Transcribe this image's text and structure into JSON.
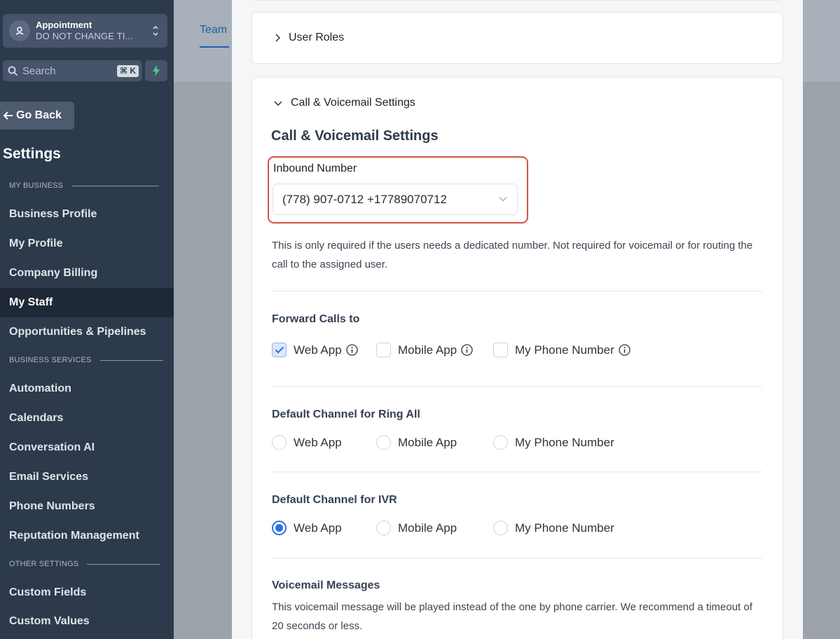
{
  "sidebar": {
    "account": {
      "name": "Appointment",
      "subtitle": "DO NOT CHANGE TI..."
    },
    "search": {
      "placeholder": "Search",
      "shortcut": "⌘ K"
    },
    "go_back": "Go Back",
    "title": "Settings",
    "sections": {
      "my_business": "MY BUSINESS",
      "business_services": "BUSINESS SERVICES",
      "other_settings": "OTHER SETTINGS"
    },
    "items": {
      "business_profile": "Business Profile",
      "my_profile": "My Profile",
      "company_billing": "Company Billing",
      "my_staff": "My Staff",
      "opportunities": "Opportunities & Pipelines",
      "automation": "Automation",
      "calendars": "Calendars",
      "conversation_ai": "Conversation AI",
      "email_services": "Email Services",
      "phone_numbers": "Phone Numbers",
      "reputation": "Reputation Management",
      "custom_fields": "Custom Fields",
      "custom_values": "Custom Values"
    },
    "active_item": "My Staff"
  },
  "background": {
    "tab": "Team"
  },
  "drawer": {
    "user_roles": "User Roles",
    "call_section_header": "Call & Voicemail Settings",
    "call_section_title": "Call & Voicemail Settings",
    "inbound_label": "Inbound Number",
    "inbound_value": "(778) 907-0712 +17789070712",
    "inbound_help": "This is only required if the users needs a dedicated number. Not required for voicemail or for routing the call to the assigned user.",
    "forward": {
      "title": "Forward Calls to",
      "web": "Web App",
      "mobile": "Mobile App",
      "phone": "My Phone Number",
      "checked": [
        "Web App"
      ]
    },
    "ring_all": {
      "title": "Default Channel for Ring All",
      "web": "Web App",
      "mobile": "Mobile App",
      "phone": "My Phone Number",
      "selected": ""
    },
    "ivr": {
      "title": "Default Channel for IVR",
      "web": "Web App",
      "mobile": "Mobile App",
      "phone": "My Phone Number",
      "selected": "Web App"
    },
    "voicemail": {
      "title": "Voicemail Messages",
      "desc": "This voicemail message will be played instead of the one by phone carrier. We recommend a timeout of 20 seconds or less."
    }
  },
  "colors": {
    "sidebar_bg": "#2d3a4b",
    "active_item_bg": "#1e2836",
    "accent_blue": "#2f6fe0",
    "highlight_red": "#d6513d"
  }
}
